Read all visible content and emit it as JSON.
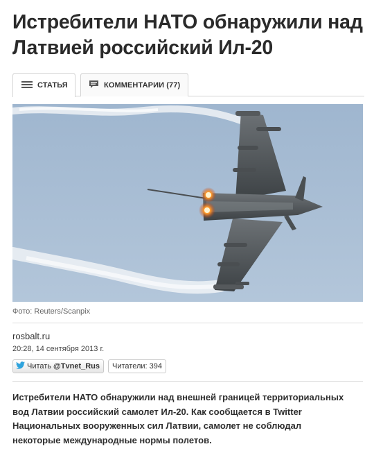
{
  "article": {
    "title": "Истребители НАТО обнаружили над Латвией российский Ил-20",
    "tabs": [
      {
        "label": "СТАТЬЯ",
        "icon": "list-icon",
        "active": true
      },
      {
        "label": "КОММЕНТАРИИ (77)",
        "icon": "comment-icon",
        "active": false
      }
    ],
    "photo": {
      "subject": "fighter-jet-photo",
      "caption": "Фото: Reuters/Scanpix"
    },
    "source": "rosbalt.ru",
    "date": "20:28, 14 сентября 2013 г.",
    "twitter": {
      "follow_label": "Читать",
      "handle": "@Tvnet_Rus",
      "readers_label": "Читатели: 394",
      "icon": "twitter-bird-icon"
    },
    "lead": "Истребители НАТО обнаружили над внешней границей территориальных вод Латвии российский самолет Ил-20. Как сообщается в Twitter Национальных вооруженных сил Латвии, самолет не соблюдал некоторые международные нормы полетов."
  },
  "colors": {
    "sky": "#a9bfd6",
    "tab_border": "#d4d4d4",
    "twitter_blue": "#2ea3dd"
  }
}
